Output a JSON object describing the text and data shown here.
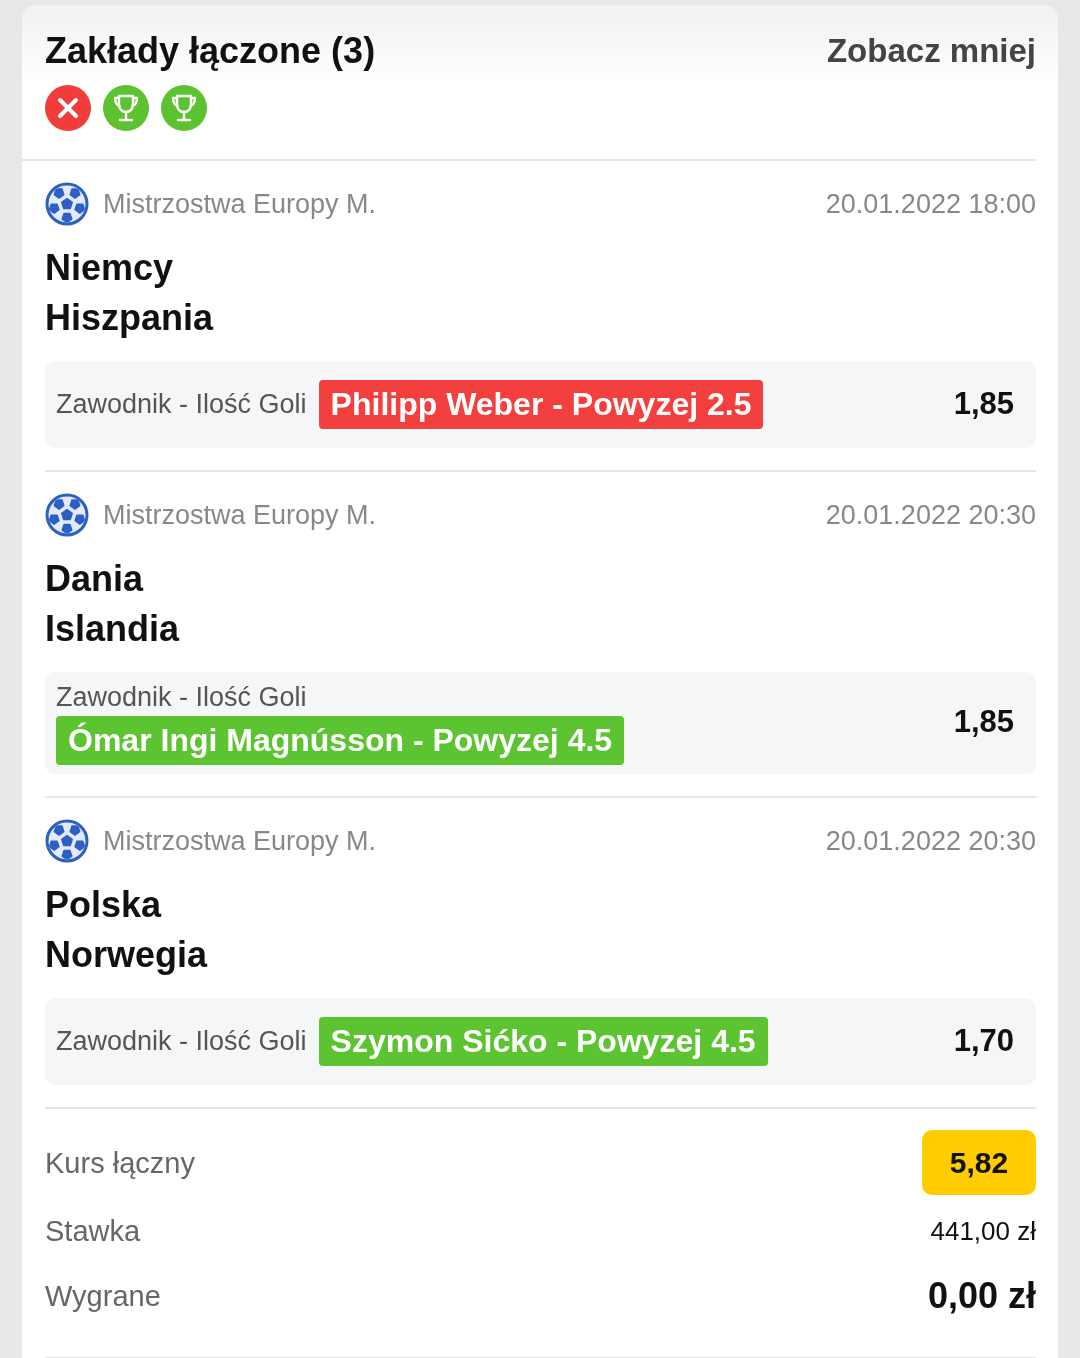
{
  "header": {
    "title": "Zakłady łączone (3)",
    "toggle": "Zobacz mniej",
    "results": [
      {
        "kind": "lost",
        "color": "#f23c3c"
      },
      {
        "kind": "won",
        "color": "#5cc22f"
      },
      {
        "kind": "won",
        "color": "#5cc22f"
      }
    ]
  },
  "events": [
    {
      "league": "Mistrzostwa Europy M.",
      "datetime": "20.01.2022 18:00",
      "teams": [
        "Niemcy",
        "Hiszpania"
      ],
      "bet": {
        "market": "Zawodnik - Ilość Goli",
        "selection": "Philipp Weber - Powyzej 2.5",
        "color": "#f43f3f",
        "odds": "1,85"
      }
    },
    {
      "league": "Mistrzostwa Europy M.",
      "datetime": "20.01.2022 20:30",
      "teams": [
        "Dania",
        "Islandia"
      ],
      "bet": {
        "market": "Zawodnik - Ilość Goli",
        "selection": "Ómar Ingi Magnússon - Powyzej 4.5",
        "color": "#5cc430",
        "odds": "1,85"
      }
    },
    {
      "league": "Mistrzostwa Europy M.",
      "datetime": "20.01.2022 20:30",
      "teams": [
        "Polska",
        "Norwegia"
      ],
      "bet": {
        "market": "Zawodnik - Ilość Goli",
        "selection": "Szymon Sićko - Powyzej 4.5",
        "color": "#5cc430",
        "odds": "1,70"
      }
    }
  ],
  "summary": {
    "total_odds_label": "Kurs łączny",
    "total_odds": "5,82",
    "stake_label": "Stawka",
    "stake": "441,00 zł",
    "winnings_label": "Wygrane",
    "winnings": "0,00 zł"
  }
}
